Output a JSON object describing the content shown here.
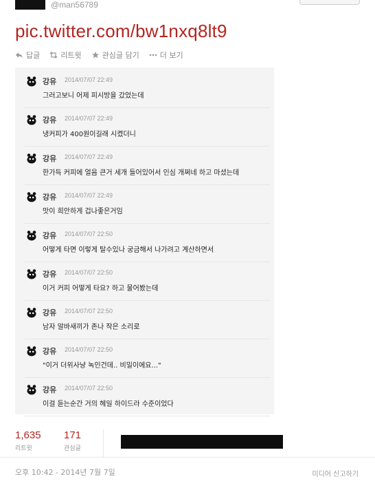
{
  "header": {
    "handle": "@man56789"
  },
  "tweet": {
    "link": "pic.twitter.com/bw1nxq8lt9"
  },
  "actions": [
    {
      "label": "답글",
      "icon": "reply-icon"
    },
    {
      "label": "리트윗",
      "icon": "retweet-icon"
    },
    {
      "label": "관심글 담기",
      "icon": "star-icon"
    },
    {
      "label": "더 보기",
      "icon": "more-dots-icon"
    }
  ],
  "chat": {
    "messages": [
      {
        "name": "강유",
        "time": "2014/07/07 22:49",
        "text": "그러고보니 어제 피시방을 갔었는데"
      },
      {
        "name": "강유",
        "time": "2014/07/07 22:49",
        "text": "냉커피가 400원이길래 시켰더니"
      },
      {
        "name": "강유",
        "time": "2014/07/07 22:49",
        "text": "한가득 커피에 얼음 큰거 세개 들어있어서 인심 개쩌네 하고 마셨는데"
      },
      {
        "name": "강유",
        "time": "2014/07/07 22:49",
        "text": "맛이 희안하게 겁나좋은거임"
      },
      {
        "name": "강유",
        "time": "2014/07/07 22:50",
        "text": "어떻게 타면 이렇게 탈수있나 궁금해서 나가려고 계산하면서"
      },
      {
        "name": "강유",
        "time": "2014/07/07 22:50",
        "text": "이거 커피 어떻게 타요? 하고 물어봤는데"
      },
      {
        "name": "강유",
        "time": "2014/07/07 22:50",
        "text": "남자 알바새끼가 존나 작은 소리로"
      },
      {
        "name": "강유",
        "time": "2014/07/07 22:50",
        "text": "\"이거 더위사냥 녹인건데.. 비밀이에요...\""
      },
      {
        "name": "강유",
        "time": "2014/07/07 22:50",
        "text": "이걸 듣는순간 거의 헤일 하이드라 수준이었다"
      }
    ]
  },
  "stats": {
    "retweets": {
      "value": "1,635",
      "label": "리트윗"
    },
    "favorites": {
      "value": "171",
      "label": "관심글"
    }
  },
  "footer": {
    "timestamp": "오후 10:42 - 2014년 7월 7일",
    "report": "미디어 신고하기"
  },
  "colors": {
    "accent": "#b22520",
    "panel_bg": "#f4f4f4",
    "muted": "#999999"
  }
}
